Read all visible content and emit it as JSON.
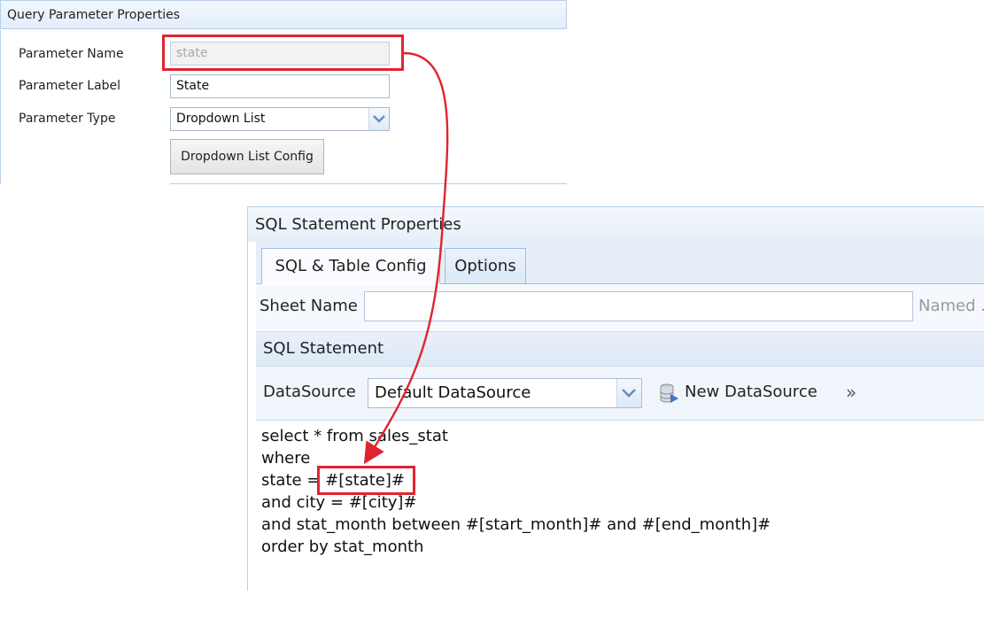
{
  "query_panel": {
    "title": "Query Parameter Properties",
    "fields": [
      {
        "label": "Parameter Name",
        "value": "state",
        "disabled": true
      },
      {
        "label": "Parameter Label",
        "value": "State"
      },
      {
        "label": "Parameter Type",
        "value": "Dropdown List"
      }
    ],
    "config_button": "Dropdown List Config"
  },
  "sql_panel": {
    "title": "SQL Statement Properties",
    "tabs": [
      {
        "label": "SQL & Table Config",
        "active": true
      },
      {
        "label": "Options",
        "active": false
      }
    ],
    "sheet_name_label": "Sheet Name",
    "sheet_name_value": "",
    "named_label_partial": "Named .",
    "sql_section_title": "SQL Statement",
    "datasource_label": "DataSource",
    "datasource_value": "Default DataSource",
    "new_datasource_label": "New DataSource",
    "more_icon": "»",
    "sql_lines": [
      "select * from sales_stat",
      "where",
      "state = #[state]#",
      "and city = #[city]#",
      "and stat_month between #[start_month]# and #[end_month]#",
      "order by stat_month"
    ]
  },
  "annotation": {
    "color": "#e0242f"
  }
}
